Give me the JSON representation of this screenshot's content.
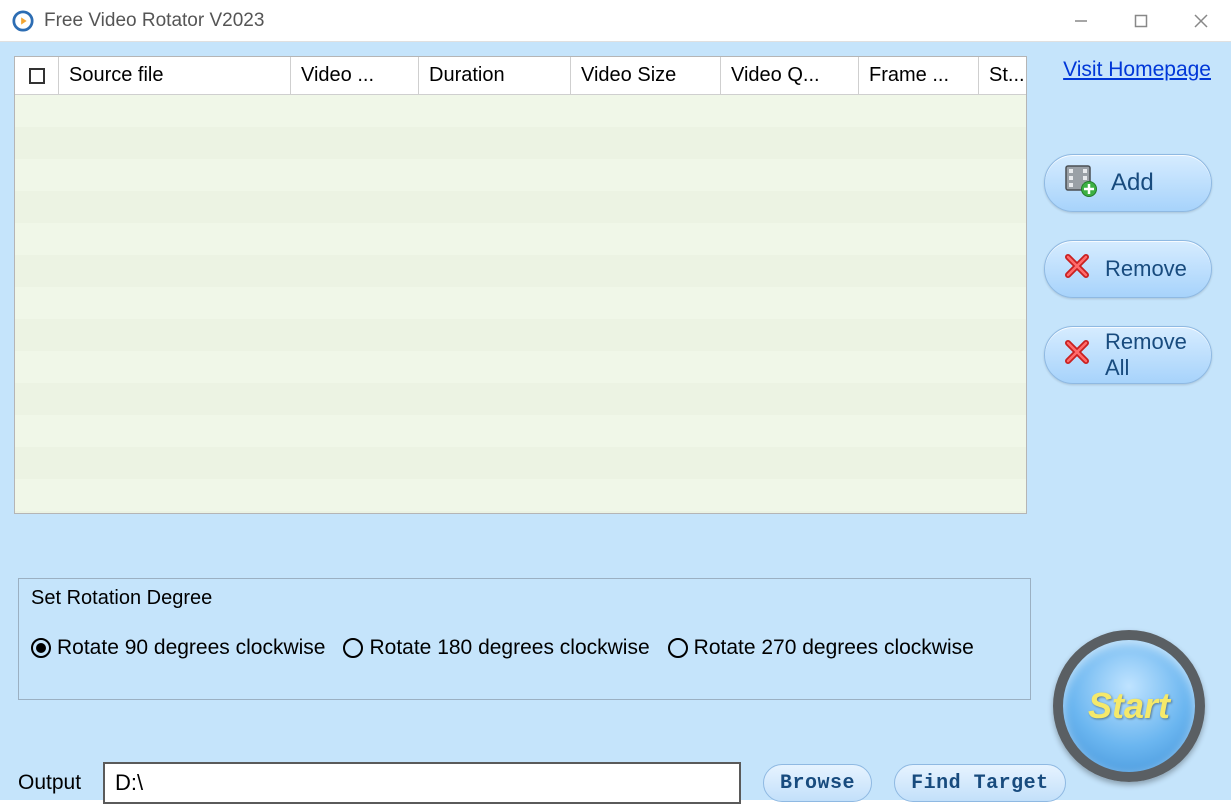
{
  "titlebar": {
    "title": "Free Video Rotator V2023"
  },
  "table": {
    "headers": {
      "source": "Source file",
      "format": "Video ...",
      "duration": "Duration",
      "size": "Video Size",
      "quality": "Video Q...",
      "frame": "Frame ...",
      "status": "St..."
    }
  },
  "side": {
    "visit": "Visit Homepage",
    "add": "Add",
    "remove": "Remove",
    "removeAll": "Remove All"
  },
  "rotation": {
    "title": "Set Rotation Degree",
    "opt90": "Rotate 90 degrees clockwise",
    "opt180": "Rotate 180 degrees clockwise",
    "opt270": "Rotate 270 degrees clockwise",
    "selected": "90"
  },
  "output": {
    "label": "Output",
    "value": "D:\\",
    "browse": "Browse",
    "findTarget": "Find Target"
  },
  "start": {
    "label": "Start"
  }
}
